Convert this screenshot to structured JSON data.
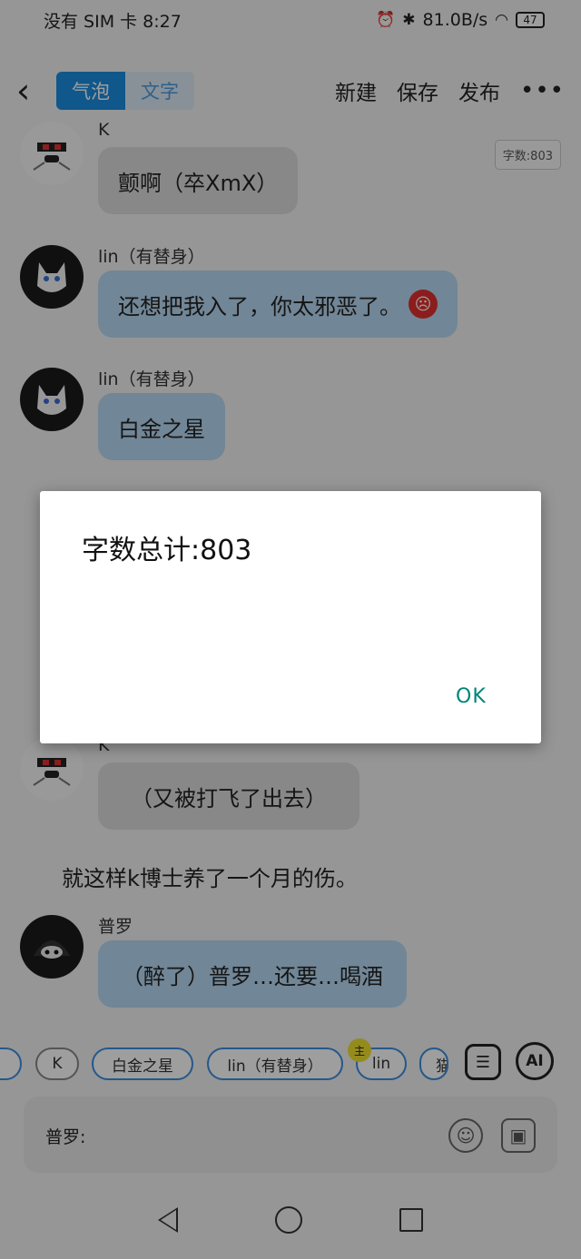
{
  "status": {
    "carrier": "没有 SIM 卡 8:27",
    "net_speed": "81.0B/s",
    "battery": "47"
  },
  "topbar": {
    "back": "‹",
    "toggle_active": "气泡",
    "toggle_inactive": "文字",
    "new": "新建",
    "save": "保存",
    "publish": "发布",
    "more": "•••"
  },
  "word_count_tag": "字数:803",
  "messages": [
    {
      "name": "K",
      "text": "颤啊（卒XmX）"
    },
    {
      "name": "lin（有替身）",
      "text": "还想把我入了，你太邪恶了。"
    },
    {
      "name": "lin（有替身）",
      "text": "白金之星"
    },
    {
      "name": "K",
      "text": "（又被打飞了出去）"
    },
    {
      "name": "普罗",
      "text": "（醉了）普罗…还要…喝酒"
    }
  ],
  "narration": "就这样k博士养了一个月的伤。",
  "chips": [
    "K",
    "白金之星",
    "lin（有替身）",
    "lin",
    "猫"
  ],
  "role_dot": "主",
  "ai_label": "AI",
  "input": {
    "label": "普罗:"
  },
  "dialog": {
    "message": "字数总计:803",
    "ok": "OK"
  },
  "icons": {
    "angry": "angry-face-icon",
    "back": "chevron-left-icon",
    "card": "contact-card-icon",
    "emoji": "smile-icon",
    "image": "image-icon"
  }
}
